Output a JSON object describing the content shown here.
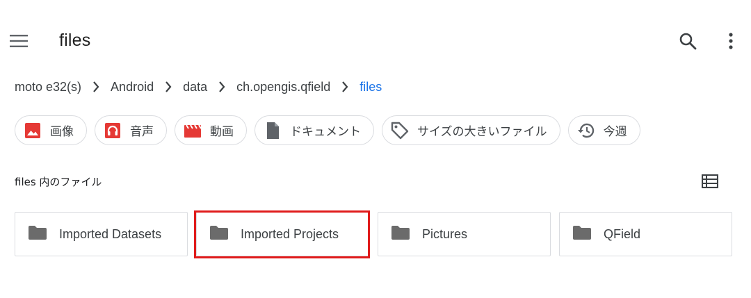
{
  "app_bar": {
    "title": "files",
    "menu_icon": "hamburger-menu-icon",
    "search_icon": "search-icon",
    "more_icon": "more-vert-icon"
  },
  "breadcrumb": {
    "items": [
      "moto e32(s)",
      "Android",
      "data",
      "ch.opengis.qfield",
      "files"
    ],
    "current_color": "#1a73e8"
  },
  "chips": [
    {
      "label": "画像",
      "icon": "image-icon",
      "color": "#e53935"
    },
    {
      "label": "音声",
      "icon": "headphones-icon",
      "color": "#e53935"
    },
    {
      "label": "動画",
      "icon": "movie-icon",
      "color": "#e53935"
    },
    {
      "label": "ドキュメント",
      "icon": "document-icon",
      "color": "#5f6368"
    },
    {
      "label": "サイズの大きいファイル",
      "icon": "tag-icon",
      "color": "#5f6368"
    },
    {
      "label": "今週",
      "icon": "history-icon",
      "color": "#5f6368"
    }
  ],
  "section": {
    "title": "files 内のファイル",
    "view_toggle_icon": "list-view-icon"
  },
  "folders": [
    {
      "label": "Imported Datasets",
      "icon": "folder-icon"
    },
    {
      "label": "Imported Projects",
      "icon": "folder-icon",
      "highlighted": true
    },
    {
      "label": "Pictures",
      "icon": "folder-icon"
    },
    {
      "label": "QField",
      "icon": "folder-icon"
    }
  ],
  "colors": {
    "highlight": "#e01b1b",
    "icon_gray": "#5f6368",
    "folder_gray": "#6b6b6b"
  }
}
